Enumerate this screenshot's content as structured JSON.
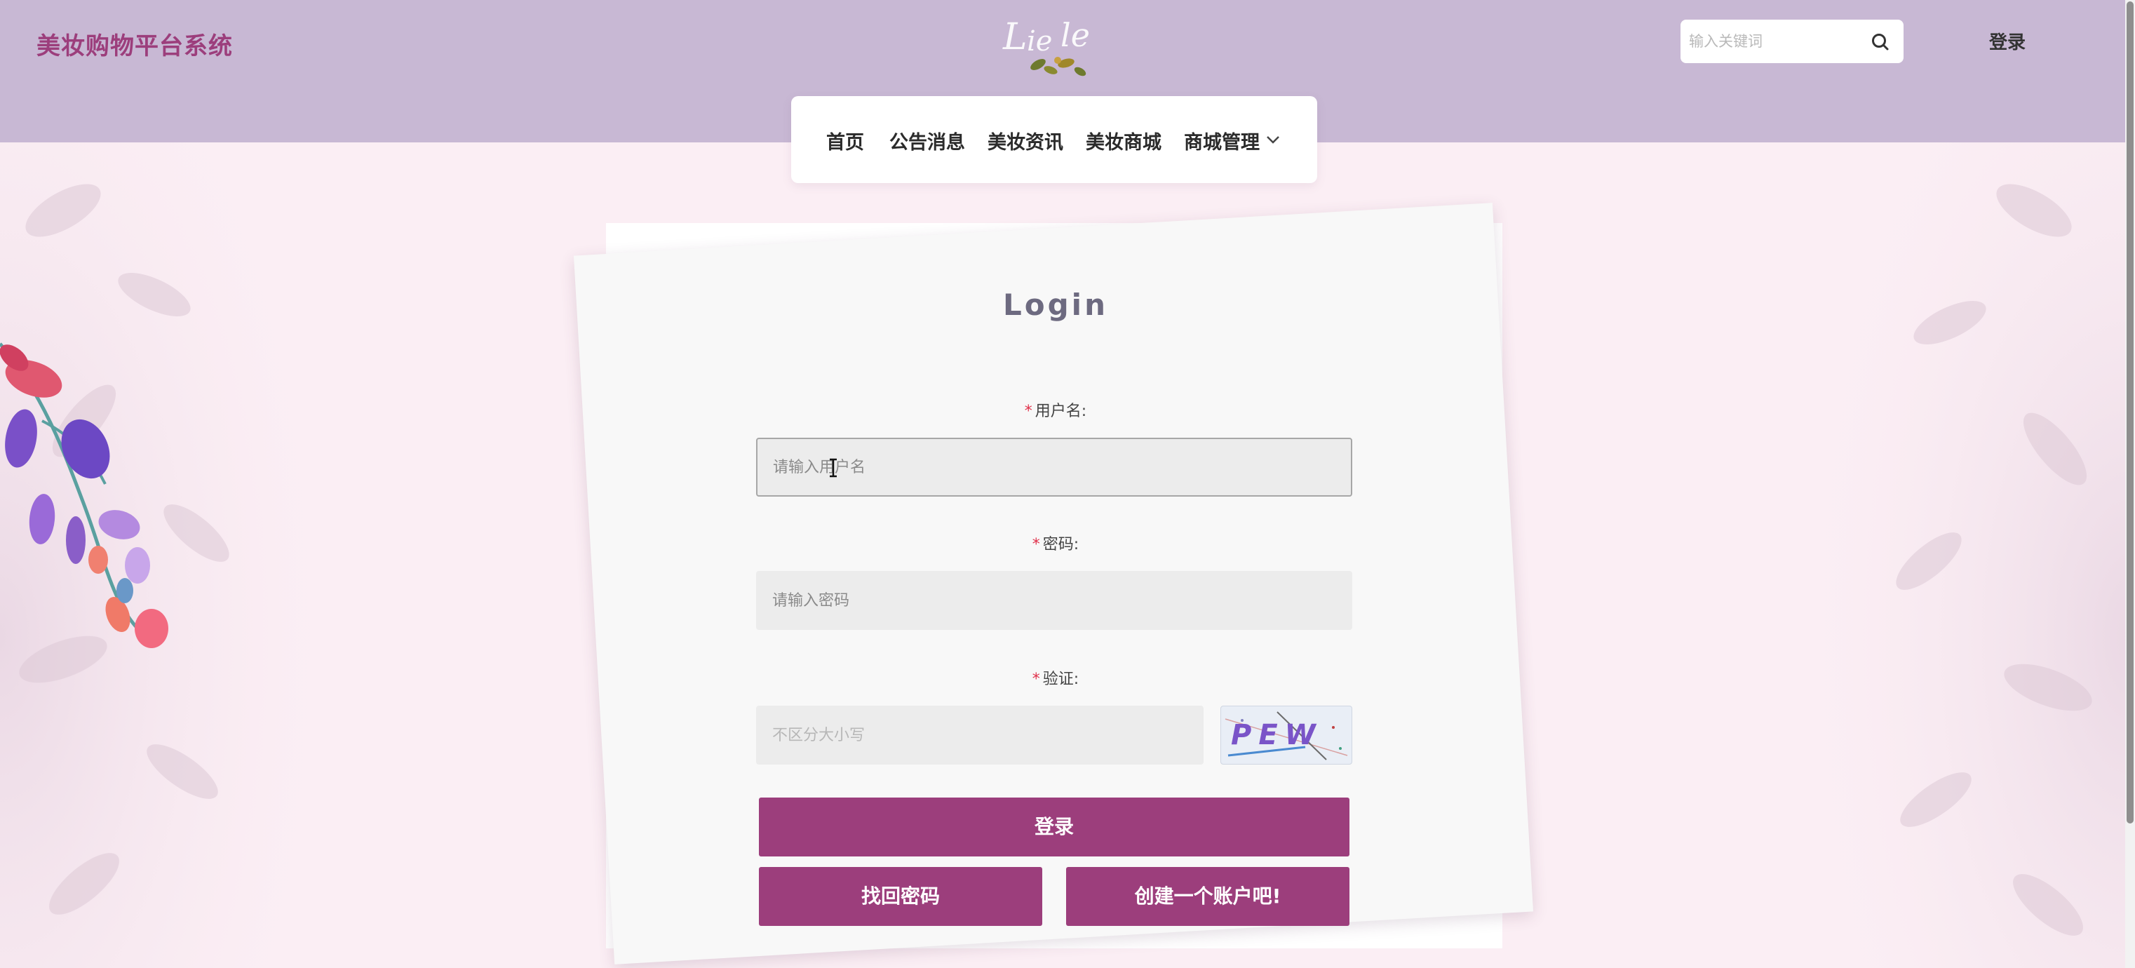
{
  "header": {
    "site_title": "美妆购物平台系统",
    "search_placeholder": "输入关键词",
    "login_link": "登录"
  },
  "nav": {
    "items": [
      "首页",
      "公告消息",
      "美妆资讯",
      "美妆商城",
      "商城管理"
    ]
  },
  "login": {
    "title": "Login",
    "required_mark": "*",
    "username_label": "用户名:",
    "username_placeholder": "请输入用户名",
    "password_label": "密码:",
    "password_placeholder": "请输入密码",
    "verify_label": "验证:",
    "verify_placeholder": "不区分大小写",
    "captcha_text": "PEW",
    "login_button": "登录",
    "forgot_button": "找回密码",
    "register_button": "创建一个账户吧!"
  },
  "colors": {
    "header_bg": "#c8b8d4",
    "brand": "#9c3e7c",
    "page_bg": "#fbeef4"
  },
  "icons": {
    "search": "search-icon",
    "nav_dropdown": "chevron-down-icon"
  }
}
